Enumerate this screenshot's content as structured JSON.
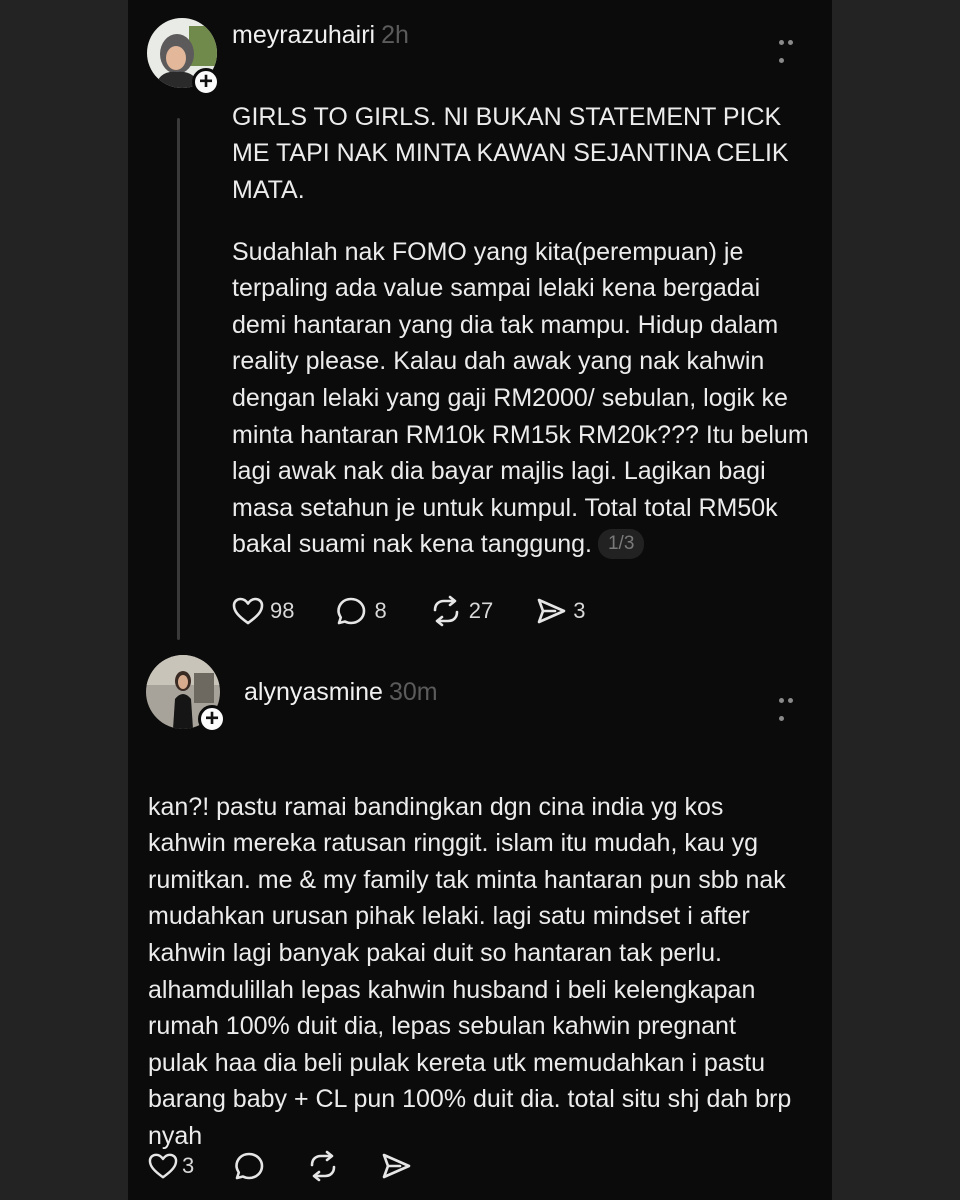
{
  "post1": {
    "username": "meyrazuhairi",
    "time": "2h",
    "heading": "GIRLS TO GIRLS. NI BUKAN STATEMENT PICK ME TAPI NAK MINTA KAWAN SEJANTINA CELIK MATA.",
    "body": "Sudahlah nak FOMO yang kita(perempuan) je terpaling ada value sampai lelaki kena bergadai demi hantaran yang dia tak mampu. Hidup dalam reality please. Kalau dah awak yang nak kahwin dengan lelaki yang gaji RM2000/ sebulan, logik ke minta hantaran RM10k RM15k RM20k??? Itu belum lagi awak nak dia bayar majlis lagi. Lagikan bagi masa setahun je untuk kumpul. Total total RM50k bakal suami nak kena tanggung.",
    "page_indicator": "1/3",
    "likes": "98",
    "replies": "8",
    "reposts": "27",
    "shares": "3"
  },
  "post2": {
    "username": "alynyasmine",
    "time": "30m",
    "body": "kan?! pastu ramai bandingkan dgn cina india yg kos kahwin mereka ratusan ringgit. islam itu mudah, kau yg rumitkan. me & my family tak minta hantaran pun sbb nak mudahkan urusan pihak lelaki. lagi satu mindset i after kahwin lagi banyak pakai duit so hantaran tak perlu. alhamdulillah lepas kahwin husband i beli kelengkapan rumah 100% duit dia, lepas sebulan kahwin pregnant pulak haa dia beli pulak kereta utk memudahkan i pastu barang baby + CL pun 100% duit dia. total situ shj dah brp nyah",
    "likes": "3"
  },
  "icons": {
    "like": "heart-icon",
    "reply": "comment-icon",
    "repost": "repost-icon",
    "share": "send-icon",
    "follow": "plus-icon",
    "more": "more-dots-icon"
  },
  "colors": {
    "background": "#0b0b0b",
    "outer": "#232323",
    "text": "#ececec",
    "muted": "#5b5b5b"
  }
}
